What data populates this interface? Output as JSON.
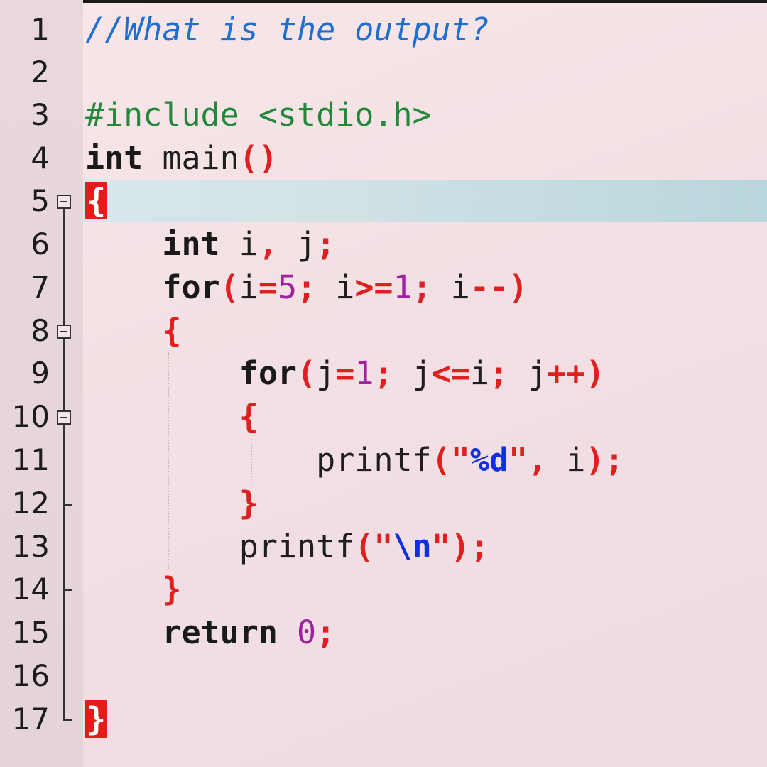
{
  "lines": [
    {
      "n": "1",
      "t": "//What is the output?"
    },
    {
      "n": "2",
      "t": ""
    },
    {
      "n": "3",
      "t": "#include <stdio.h>"
    },
    {
      "n": "4",
      "t": "int main()"
    },
    {
      "n": "5",
      "t": "{"
    },
    {
      "n": "6",
      "t": "    int i, j;"
    },
    {
      "n": "7",
      "t": "    for(i=5; i>=1; i--)"
    },
    {
      "n": "8",
      "t": "    {"
    },
    {
      "n": "9",
      "t": "        for(j=1; j<=i; j++)"
    },
    {
      "n": "10",
      "t": "        {"
    },
    {
      "n": "11",
      "t": "            printf(\"%d\", i);"
    },
    {
      "n": "12",
      "t": "        }"
    },
    {
      "n": "13",
      "t": "        printf(\"\\n\");"
    },
    {
      "n": "14",
      "t": "    }"
    },
    {
      "n": "15",
      "t": "    return 0;"
    },
    {
      "n": "16",
      "t": ""
    },
    {
      "n": "17",
      "t": "}"
    }
  ],
  "highlighted_line": "5",
  "colors": {
    "comment": "#1f6fd0",
    "preprocessor": "#23883a",
    "operator": "#e02020",
    "number": "#a020a0",
    "string": "#1030e0",
    "current_line": "#cfe2e6",
    "brace_match": "#e21b1b"
  }
}
